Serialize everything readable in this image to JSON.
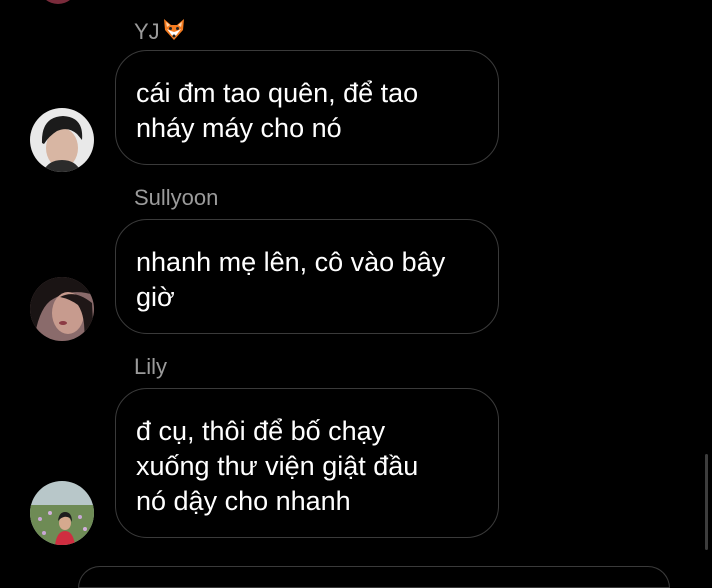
{
  "messages": [
    {
      "sender": "YJ",
      "sender_emoji": "fox-face-emoji",
      "text": "cái đm tao quên, để tao\nnháy máy cho nó"
    },
    {
      "sender": "Sullyoon",
      "text": "nhanh mẹ lên, cô vào bây\ngiờ"
    },
    {
      "sender": "Lily",
      "text": "đ cụ, thôi để bố chạy\nxuống thư viện giật đầu\nnó dậy cho nhanh"
    }
  ],
  "colors": {
    "background": "#000000",
    "bubble_border": "#3a3a3a",
    "sender_name": "#9b9b9b",
    "message_text": "#ffffff"
  }
}
